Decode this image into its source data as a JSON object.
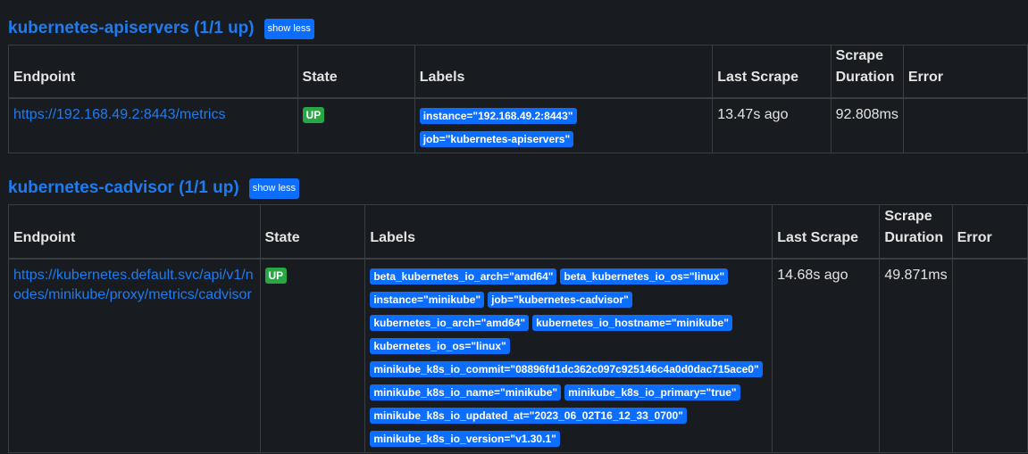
{
  "columns": {
    "endpoint": "Endpoint",
    "state": "State",
    "labels": "Labels",
    "last_scrape": "Last Scrape",
    "scrape_duration": "Scrape Duration",
    "error": "Error"
  },
  "pools": [
    {
      "title": "kubernetes-apiservers (1/1 up)",
      "button": "show less",
      "rows": [
        {
          "endpoint": "https://192.168.49.2:8443/metrics",
          "state": "UP",
          "labels": [
            "instance=\"192.168.49.2:8443\"",
            "job=\"kubernetes-apiservers\""
          ],
          "last_scrape": "13.47s ago",
          "scrape_duration": "92.808ms",
          "error": ""
        }
      ]
    },
    {
      "title": "kubernetes-cadvisor (1/1 up)",
      "button": "show less",
      "rows": [
        {
          "endpoint": "https://kubernetes.default.svc/api/v1/nodes/minikube/proxy/metrics/cadvisor",
          "state": "UP",
          "labels": [
            "beta_kubernetes_io_arch=\"amd64\"",
            "beta_kubernetes_io_os=\"linux\"",
            "instance=\"minikube\"",
            "job=\"kubernetes-cadvisor\"",
            "kubernetes_io_arch=\"amd64\"",
            "kubernetes_io_hostname=\"minikube\"",
            "kubernetes_io_os=\"linux\"",
            "minikube_k8s_io_commit=\"08896fd1dc362c097c925146c4a0d0dac715ace0\"",
            "minikube_k8s_io_name=\"minikube\"",
            "minikube_k8s_io_primary=\"true\"",
            "minikube_k8s_io_updated_at=\"2023_06_02T16_12_33_0700\"",
            "minikube_k8s_io_version=\"v1.30.1\""
          ],
          "last_scrape": "14.68s ago",
          "scrape_duration": "49.871ms",
          "error": ""
        }
      ]
    }
  ],
  "colors": {
    "background": "#181b1f",
    "link": "#1f7cf0",
    "badge": "#0d6efd",
    "up": "#28a745"
  }
}
